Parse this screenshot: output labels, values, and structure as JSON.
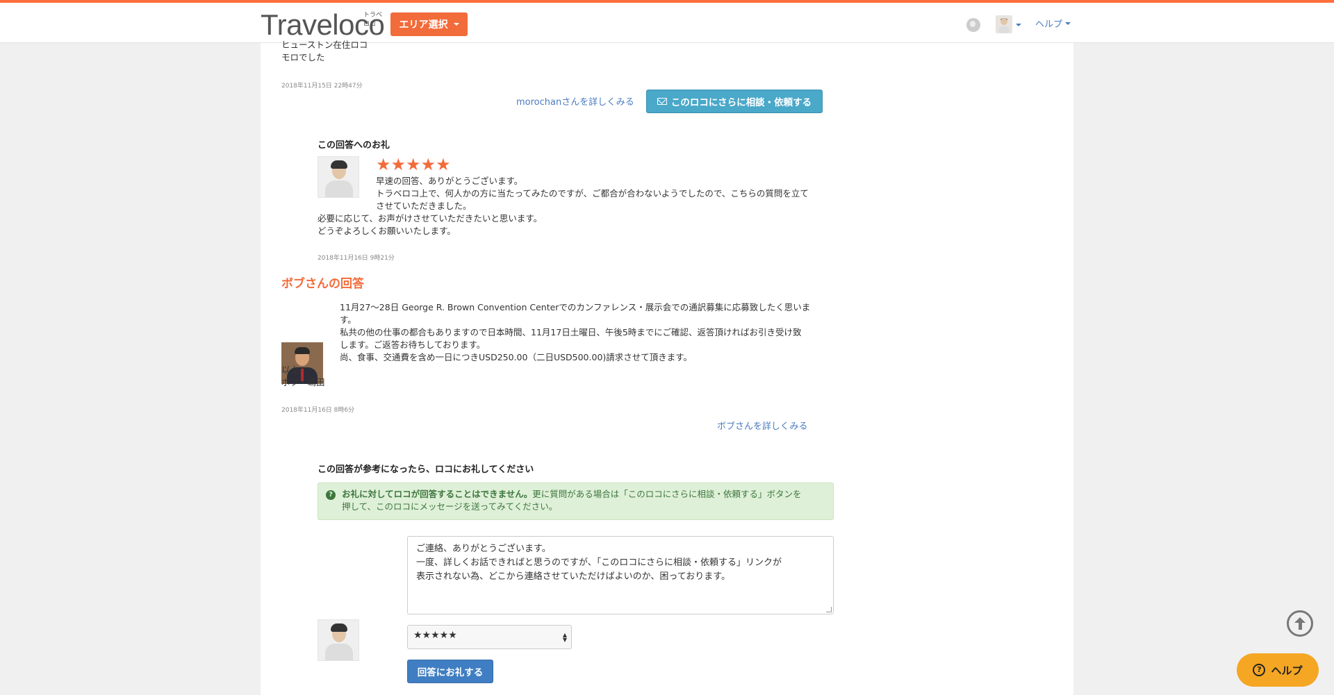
{
  "header": {
    "logo": "Traveloco",
    "logo_kana": "トラベロコ",
    "area_button": "エリア選択",
    "help_menu": "ヘルプ"
  },
  "top_answer": {
    "partial_line1": "ヒューストン在住ロコ",
    "partial_line2": "モロでした",
    "timestamp": "2018年11月15日 22時47分",
    "detail_link": "morochanさんを詳しくみる",
    "consult_button": "このロコにさらに相談・依頼する"
  },
  "thanks": {
    "heading": "この回答へのお礼",
    "stars": "★★★★★",
    "lines": [
      "早速の回答、ありがとうございます。",
      "トラベロコ上で、何人かの方に当たってみたのですが、ご都合が合わないようでしたので、こちらの質問を立て",
      "させていただきました。",
      "必要に応じて、お声がけさせていただきたいと思います。",
      "どうぞよろしくお願いいたします。"
    ],
    "timestamp": "2018年11月16日 9時21分"
  },
  "bob_answer": {
    "title": "ボブさんの回答",
    "lines": [
      "11月27〜28日 George R. Brown Convention Centerでのカンファレンス・展示会での通訳募集に応募致したく思いま",
      "す。",
      "私共の他の仕事の都合もありますので日本時間、11月17日土曜日、午後5時までにご確認、返答頂ければお引き受け致",
      "します。ご返答お待ちしております。",
      "尚、食事、交通費を含め一日につきUSD250.00（二日USD500.00)請求させて頂きます。"
    ],
    "sign1": "以上",
    "sign2": "ボブ・嶋田",
    "timestamp": "2018年11月16日 8時6分",
    "detail_link": "ボブさんを詳しくみる"
  },
  "reply_form": {
    "heading": "この回答が参考になったら、ロコにお礼してください",
    "notice_bold": "お礼に対してロコが回答することはできません。",
    "notice_rest1": "更に質問がある場合は「このロコにさらに相談・依頼する」ボタンを",
    "notice_rest2": "押して、このロコにメッセージを送ってみてください。",
    "textarea_lines": [
      "ご連絡、ありがとうございます。",
      "一度、詳しくお話できればと思うのですが、「このロコにさらに相談・依頼する」リンクが",
      "表示されない為、どこから連絡させていただけばよいのか、困っております。"
    ],
    "rating_selected": "★★★★★",
    "submit_button": "回答にお礼する"
  },
  "floating": {
    "help_button": "ヘルプ"
  }
}
